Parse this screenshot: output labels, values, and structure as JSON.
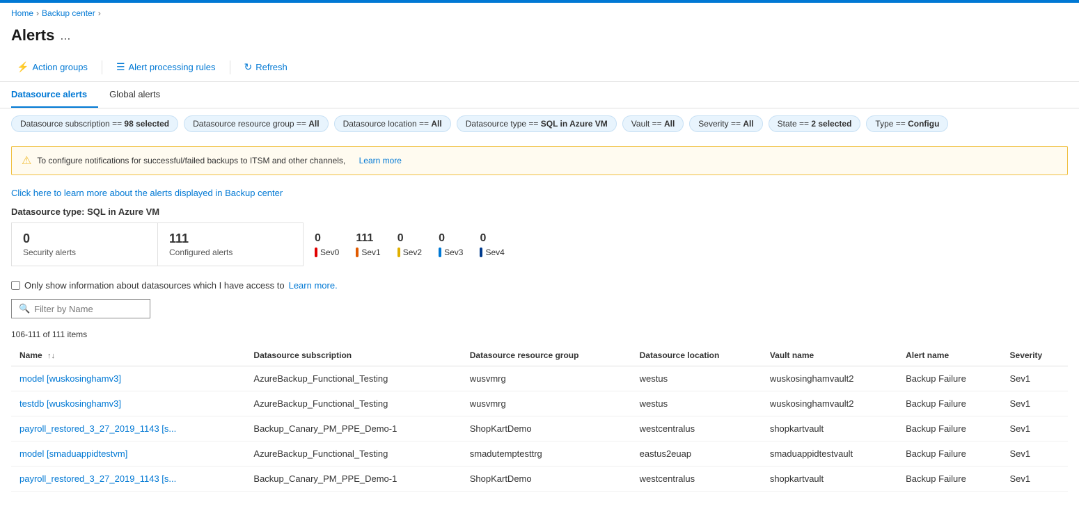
{
  "topbar": {
    "color": "#0078d4"
  },
  "breadcrumb": {
    "items": [
      "Home",
      "Backup center"
    ]
  },
  "page": {
    "title": "Alerts",
    "ellipsis": "..."
  },
  "toolbar": {
    "action_groups_label": "Action groups",
    "alert_processing_rules_label": "Alert processing rules",
    "refresh_label": "Refresh"
  },
  "tabs": [
    {
      "label": "Datasource alerts",
      "active": true
    },
    {
      "label": "Global alerts",
      "active": false
    }
  ],
  "filters": [
    {
      "prefix": "Datasource subscription == ",
      "value": "98 selected"
    },
    {
      "prefix": "Datasource resource group == ",
      "value": "All"
    },
    {
      "prefix": "Datasource location == ",
      "value": "All"
    },
    {
      "prefix": "Datasource type == ",
      "value": "SQL in Azure VM"
    },
    {
      "prefix": "Vault == ",
      "value": "All"
    },
    {
      "prefix": "Severity == ",
      "value": "All"
    },
    {
      "prefix": "State == ",
      "value": "2 selected"
    },
    {
      "prefix": "Type == ",
      "value": "Configu"
    }
  ],
  "warning": {
    "text": "To configure notifications for successful/failed backups to ITSM and other channels,",
    "link_text": "Learn more",
    "link_url": "#"
  },
  "info_link": {
    "text": "Click here to learn more about the alerts displayed in Backup center",
    "url": "#"
  },
  "datasource_type_label": "Datasource type: SQL in Azure VM",
  "summary_cards": [
    {
      "number": "0",
      "label": "Security alerts"
    },
    {
      "number": "111",
      "label": "Configured alerts"
    }
  ],
  "severity_stats": [
    {
      "number": "0",
      "label": "Sev0",
      "color": "#e00000"
    },
    {
      "number": "111",
      "label": "Sev1",
      "color": "#e05a00"
    },
    {
      "number": "0",
      "label": "Sev2",
      "color": "#e0b000"
    },
    {
      "number": "0",
      "label": "Sev3",
      "color": "#0078d4"
    },
    {
      "number": "0",
      "label": "Sev4",
      "color": "#003a8c"
    }
  ],
  "checkbox_row": {
    "label": "Only show information about datasources which I have access to",
    "link_text": "Learn more.",
    "link_url": "#"
  },
  "search": {
    "placeholder": "Filter by Name"
  },
  "items_count": "106-111 of 111 items",
  "table": {
    "columns": [
      {
        "label": "Name",
        "sortable": true
      },
      {
        "label": "Datasource subscription",
        "sortable": false
      },
      {
        "label": "Datasource resource group",
        "sortable": false
      },
      {
        "label": "Datasource location",
        "sortable": false
      },
      {
        "label": "Vault name",
        "sortable": false
      },
      {
        "label": "Alert name",
        "sortable": false
      },
      {
        "label": "Severity",
        "sortable": false
      }
    ],
    "rows": [
      {
        "name": "model [wuskosinghamv3]",
        "subscription": "AzureBackup_Functional_Testing",
        "resource_group": "wusvmrg",
        "location": "westus",
        "vault_name": "wuskosinghamvault2",
        "alert_name": "Backup Failure",
        "severity": "Sev1"
      },
      {
        "name": "testdb [wuskosinghamv3]",
        "subscription": "AzureBackup_Functional_Testing",
        "resource_group": "wusvmrg",
        "location": "westus",
        "vault_name": "wuskosinghamvault2",
        "alert_name": "Backup Failure",
        "severity": "Sev1"
      },
      {
        "name": "payroll_restored_3_27_2019_1143 [s...",
        "subscription": "Backup_Canary_PM_PPE_Demo-1",
        "resource_group": "ShopKartDemo",
        "location": "westcentralus",
        "vault_name": "shopkartvault",
        "alert_name": "Backup Failure",
        "severity": "Sev1"
      },
      {
        "name": "model [smaduappidtestvm]",
        "subscription": "AzureBackup_Functional_Testing",
        "resource_group": "smadutemptesttrg",
        "location": "eastus2euap",
        "vault_name": "smaduappidtestvault",
        "alert_name": "Backup Failure",
        "severity": "Sev1"
      },
      {
        "name": "payroll_restored_3_27_2019_1143 [s...",
        "subscription": "Backup_Canary_PM_PPE_Demo-1",
        "resource_group": "ShopKartDemo",
        "location": "westcentralus",
        "vault_name": "shopkartvault",
        "alert_name": "Backup Failure",
        "severity": "Sev1"
      }
    ]
  }
}
